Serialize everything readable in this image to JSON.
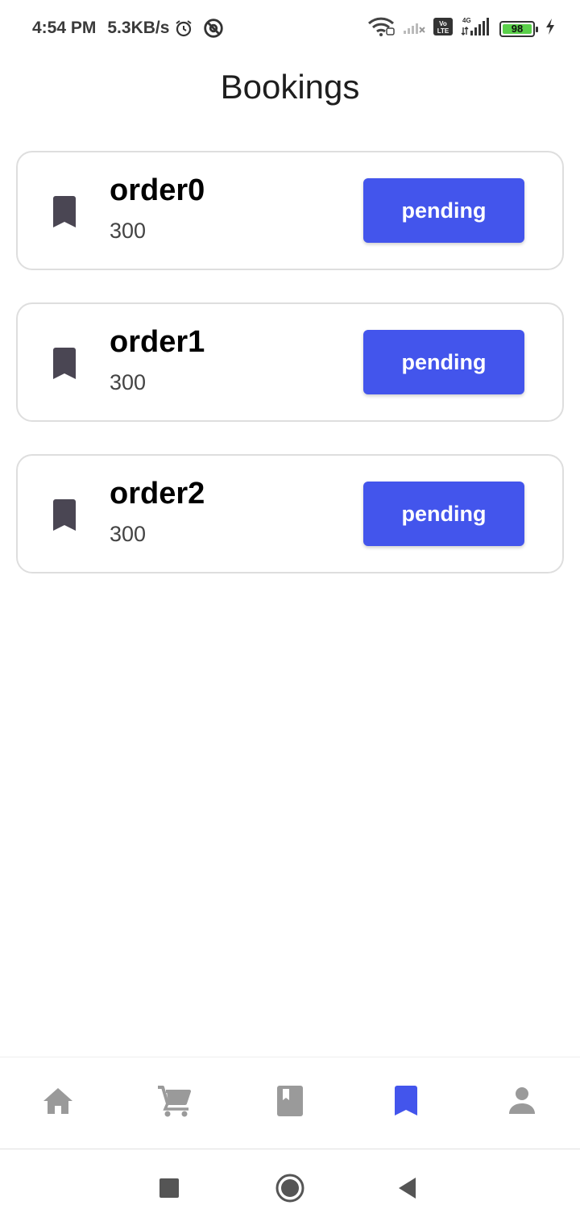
{
  "status_bar": {
    "time": "4:54 PM",
    "network_speed": "5.3KB/s",
    "battery_level": "98",
    "icons": [
      "alarm-icon",
      "vpn-icon",
      "wifi-icon",
      "signal-weak-icon",
      "volte-icon",
      "signal-4g-icon",
      "battery-icon",
      "charging-icon"
    ]
  },
  "header": {
    "title": "Bookings"
  },
  "bookings": [
    {
      "name": "order0",
      "amount": "300",
      "status": "pending",
      "icon": "bookmark-icon"
    },
    {
      "name": "order1",
      "amount": "300",
      "status": "pending",
      "icon": "bookmark-icon"
    },
    {
      "name": "order2",
      "amount": "300",
      "status": "pending",
      "icon": "bookmark-icon"
    }
  ],
  "bottom_nav": {
    "items": [
      {
        "icon": "home-icon",
        "active": false
      },
      {
        "icon": "cart-icon",
        "active": false
      },
      {
        "icon": "book-icon",
        "active": false
      },
      {
        "icon": "bookmark-icon",
        "active": true
      },
      {
        "icon": "person-icon",
        "active": false
      }
    ]
  },
  "system_nav": {
    "buttons": [
      "recents-icon",
      "home-circle-icon",
      "back-icon"
    ]
  },
  "colors": {
    "accent": "#4355ec",
    "nav_inactive": "#9a9a9a",
    "card_icon": "#4a4653",
    "card_border": "#dedede"
  }
}
